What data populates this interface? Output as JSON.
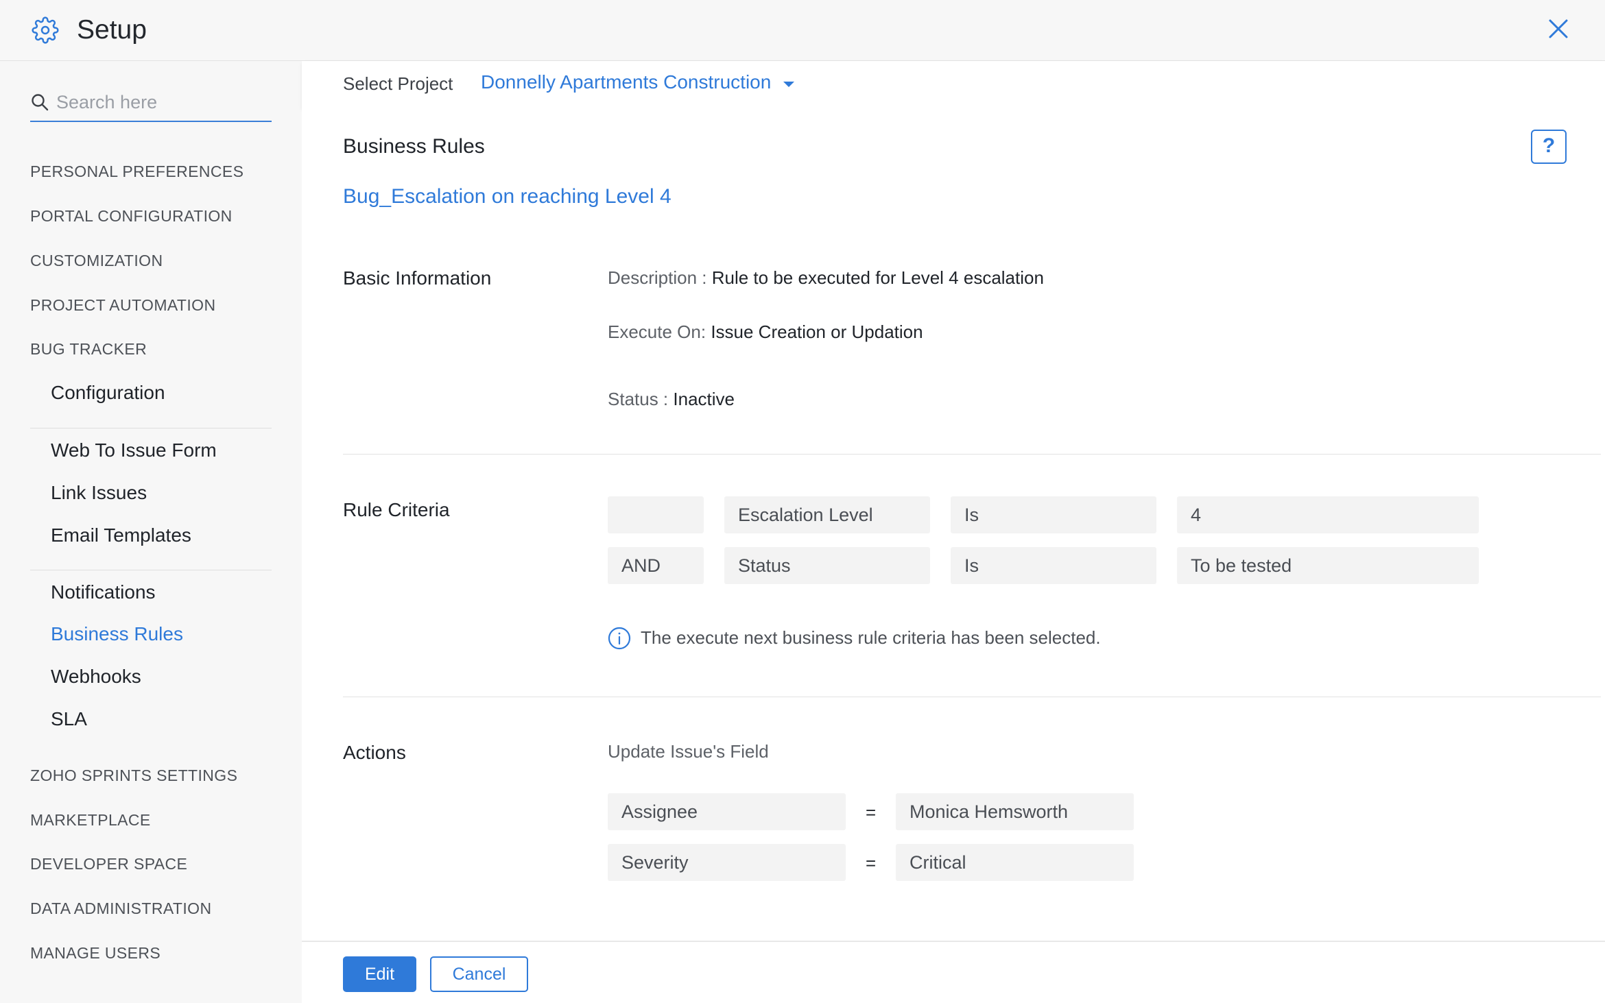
{
  "header": {
    "title": "Setup",
    "settings_icon": "gear-icon",
    "close_icon": "close-icon"
  },
  "sidebar": {
    "search_placeholder": "Search here",
    "sections": {
      "personal_preferences": "PERSONAL PREFERENCES",
      "portal_configuration": "PORTAL CONFIGURATION",
      "customization": "CUSTOMIZATION",
      "project_automation": "PROJECT AUTOMATION",
      "bug_tracker": "BUG TRACKER",
      "zoho_sprints_settings": "ZOHO SPRINTS SETTINGS",
      "marketplace": "MARKETPLACE",
      "developer_space": "DEVELOPER SPACE",
      "data_administration": "DATA ADMINISTRATION",
      "manage_users": "MANAGE USERS"
    },
    "bug_tracker_items": {
      "configuration": "Configuration",
      "web_to_issue_form": "Web To Issue Form",
      "link_issues": "Link Issues",
      "email_templates": "Email Templates",
      "notifications": "Notifications",
      "business_rules": "Business Rules",
      "webhooks": "Webhooks",
      "sla": "SLA"
    },
    "active_item": "Business Rules"
  },
  "project_bar": {
    "label": "Select Project",
    "selected_project": "Donnelly Apartments Construction"
  },
  "main": {
    "page_title": "Business Rules",
    "help_label": "?",
    "rule_name": "Bug_Escalation on reaching Level 4",
    "basic_information": {
      "title": "Basic Information",
      "description_label": "Description :",
      "description_value": "Rule to be executed for Level 4 escalation",
      "execute_on_label": "Execute On:",
      "execute_on_value": "Issue Creation or Updation",
      "status_label": "Status :",
      "status_value": "Inactive"
    },
    "rule_criteria": {
      "title": "Rule Criteria",
      "rows": [
        {
          "connector": "",
          "field": "Escalation Level",
          "operator": "Is",
          "value": "4"
        },
        {
          "connector": "AND",
          "field": "Status",
          "operator": "Is",
          "value": "To be tested"
        }
      ],
      "info_text": "The execute next business rule criteria has been selected."
    },
    "actions": {
      "title": "Actions",
      "subtitle": "Update Issue's Field",
      "rows": [
        {
          "field": "Assignee",
          "operator": "=",
          "value": "Monica Hemsworth"
        },
        {
          "field": "Severity",
          "operator": "=",
          "value": "Critical"
        }
      ]
    }
  },
  "footer": {
    "edit_label": "Edit",
    "cancel_label": "Cancel"
  },
  "colors": {
    "accent": "#2f7ad9",
    "sidebar_bg": "#f7f7f7",
    "field_bg": "#f3f3f3"
  }
}
